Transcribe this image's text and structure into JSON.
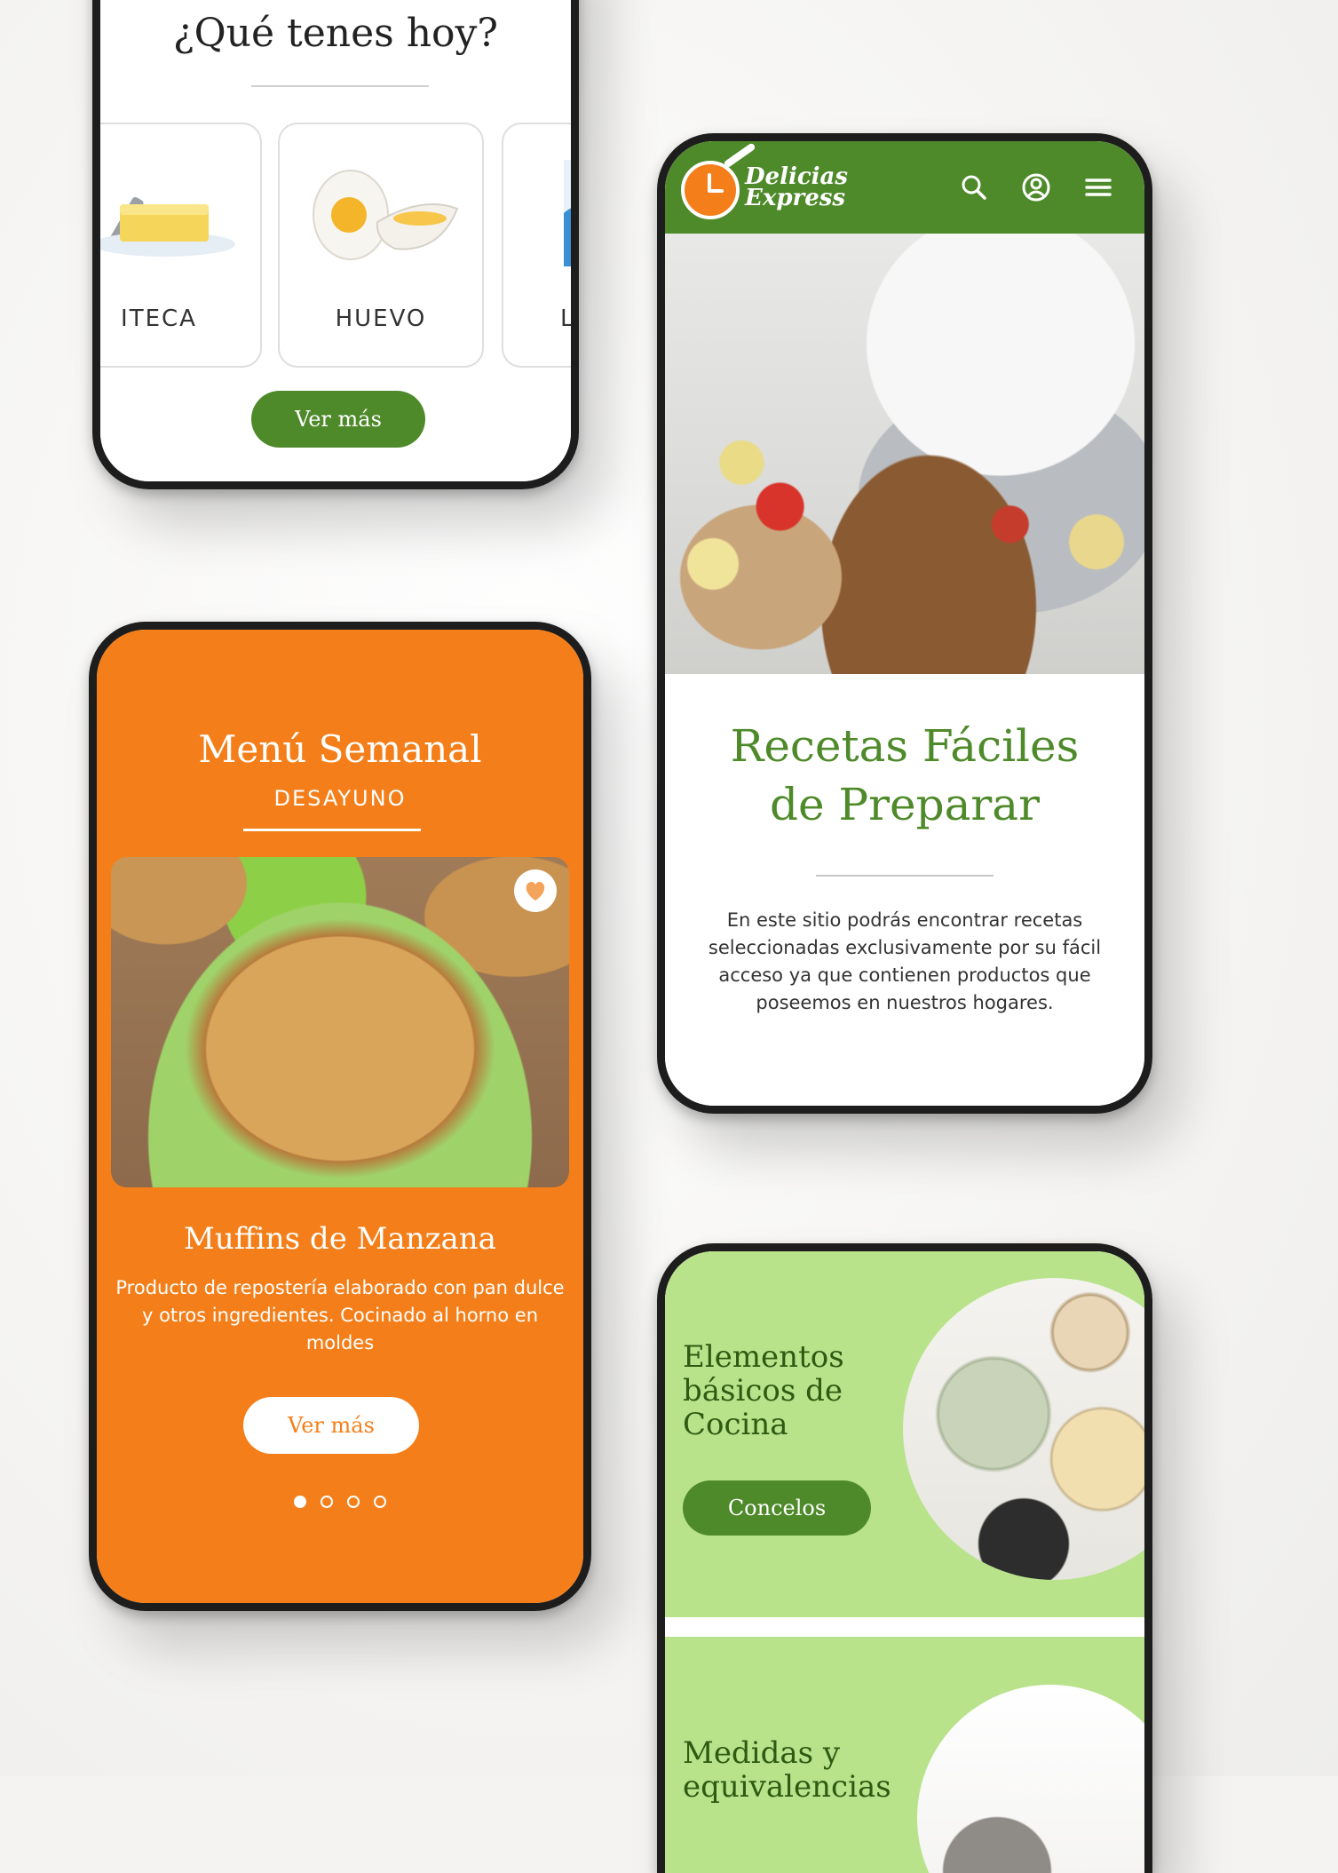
{
  "ingredients_screen": {
    "title": "¿Qué tenes hoy?",
    "items": [
      {
        "label": "ITECA",
        "icon": "butter-icon"
      },
      {
        "label": "HUEVO",
        "icon": "egg-icon"
      },
      {
        "label": "LEC",
        "icon": "milk-carton-icon"
      }
    ],
    "button": "Ver más"
  },
  "home_screen": {
    "logo": {
      "line1": "Delicias",
      "line2": "Express"
    },
    "header_icons": [
      "search-icon",
      "user-icon",
      "menu-icon"
    ],
    "title_line1": "Recetas Fáciles",
    "title_line2": "de Preparar",
    "body": "En este sitio podrás encontrar recetas seleccionadas exclusivamente por su fácil acceso ya que contienen productos que poseemos en nuestros hogares."
  },
  "menu_screen": {
    "title": "Menú Semanal",
    "subtitle": "DESAYUNO",
    "recipe_name": "Muffins de Manzana",
    "description": "Producto de repostería elaborado con pan dulce y otros ingredientes. Cocinado al horno en moldes",
    "button": "Ver más",
    "carousel": {
      "count": 4,
      "active": 0
    }
  },
  "elements_screen": {
    "card1_title": "Elementos básicos de Cocina",
    "card1_button": "Concelos",
    "card2_title": "Medidas y equivalencias"
  },
  "colors": {
    "brand_green": "#4e8a2a",
    "brand_orange": "#f47f1a",
    "light_green": "#b8e38b"
  }
}
